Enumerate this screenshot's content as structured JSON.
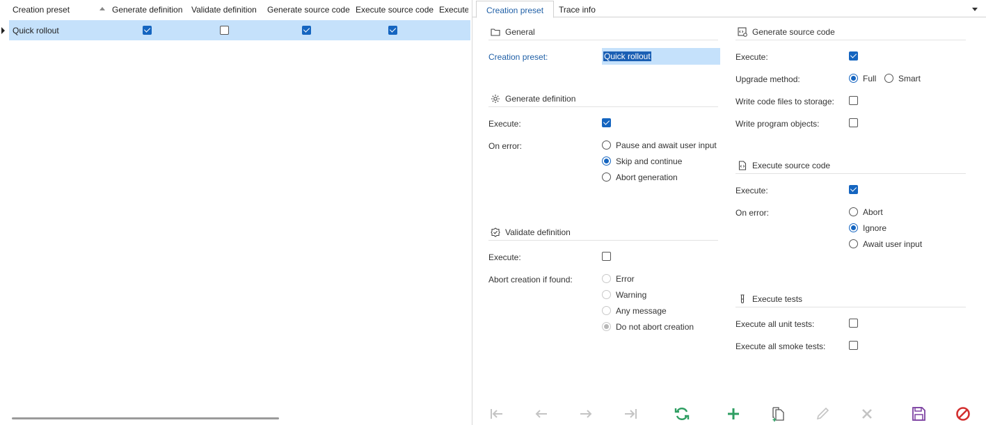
{
  "grid": {
    "columns": [
      "Creation preset",
      "Generate definition",
      "Validate definition",
      "Generate source code",
      "Execute source code",
      "Execute"
    ],
    "rows": [
      {
        "name": "Quick rollout",
        "generate_definition": true,
        "validate_definition": false,
        "generate_source_code": true,
        "execute_source_code": true
      }
    ]
  },
  "tabs": [
    "Creation preset",
    "Trace info"
  ],
  "general": {
    "title": "General",
    "preset_label": "Creation preset:",
    "preset_value": "Quick rollout"
  },
  "generate_definition": {
    "title": "Generate definition",
    "execute_label": "Execute:",
    "execute": true,
    "on_error_label": "On error:",
    "on_error_options": [
      "Pause and await user input",
      "Skip and continue",
      "Abort generation"
    ],
    "on_error_selected": "Skip and continue"
  },
  "validate_definition": {
    "title": "Validate definition",
    "execute_label": "Execute:",
    "execute": false,
    "abort_label": "Abort creation if found:",
    "abort_options": [
      "Error",
      "Warning",
      "Any message",
      "Do not abort creation"
    ],
    "abort_selected": "Do not abort creation"
  },
  "generate_source_code": {
    "title": "Generate source code",
    "execute_label": "Execute:",
    "execute": true,
    "upgrade_label": "Upgrade method:",
    "upgrade_options": [
      "Full",
      "Smart"
    ],
    "upgrade_selected": "Full",
    "write_files_label": "Write code files to storage:",
    "write_files": false,
    "write_objects_label": "Write program objects:",
    "write_objects": false
  },
  "execute_source_code": {
    "title": "Execute source code",
    "execute_label": "Execute:",
    "execute": true,
    "on_error_label": "On error:",
    "on_error_options": [
      "Abort",
      "Ignore",
      "Await user input"
    ],
    "on_error_selected": "Ignore"
  },
  "execute_tests": {
    "title": "Execute tests",
    "unit_label": "Execute all unit tests:",
    "unit": false,
    "smoke_label": "Execute all smoke tests:",
    "smoke": false
  },
  "toolbar": [
    "first-icon",
    "previous-icon",
    "next-icon",
    "last-icon",
    "refresh-icon",
    "add-icon",
    "copy-icon",
    "edit-icon",
    "delete-icon",
    "save-icon",
    "cancel-icon"
  ],
  "colors": {
    "accent": "#1565c0",
    "selection": "#c5e1fb",
    "link": "#1f5fa6",
    "refresh": "#2e9e62",
    "add": "#2e9e62",
    "save": "#7b3fa0",
    "cancel": "#d32f2f"
  }
}
